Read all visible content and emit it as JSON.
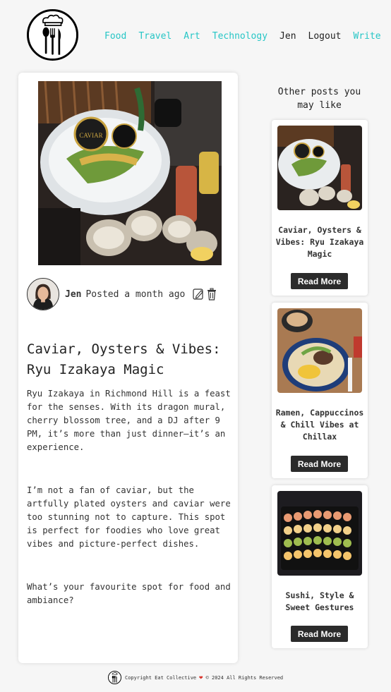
{
  "nav": {
    "links": [
      {
        "label": "Food",
        "accent": true
      },
      {
        "label": "Travel",
        "accent": true
      },
      {
        "label": "Art",
        "accent": true
      },
      {
        "label": "Technology",
        "accent": true
      },
      {
        "label": "Jen",
        "accent": false
      },
      {
        "label": "Logout",
        "accent": false
      },
      {
        "label": "Write",
        "accent": true
      }
    ],
    "accent_color": "#27c6c6"
  },
  "post": {
    "author": "Jen",
    "posted": "Posted a month ago",
    "title": "Caviar, Oysters & Vibes: Ryu Izakaya Magic",
    "paragraphs": [
      "Ryu Izakaya in Richmond Hill is a feast for the senses. With its dragon mural, cherry blossom tree, and a DJ after 9 PM, it’s more than just dinner—it’s an experience.",
      "I’m not a fan of caviar, but the artfully plated oysters and caviar were too stunning not to capture. This spot is perfect for foodies who love great vibes and picture-perfect dishes.",
      "What’s your favourite spot for food and ambiance?"
    ],
    "icons": [
      "edit-icon",
      "trash-icon"
    ]
  },
  "sidebar": {
    "title": "Other posts you may like",
    "cards": [
      {
        "title": "Caviar, Oysters & Vibes: Ryu Izakaya Magic",
        "button": "Read More"
      },
      {
        "title": "Ramen, Cappuccinos & Chill Vibes at Chillax",
        "button": "Read More"
      },
      {
        "title": "Sushi, Style & Sweet Gestures",
        "button": "Read More"
      }
    ]
  },
  "footer": {
    "left": "Copyright Eat Collective",
    "heart": "❤",
    "right": "© 2024 All Rights Reserved"
  }
}
